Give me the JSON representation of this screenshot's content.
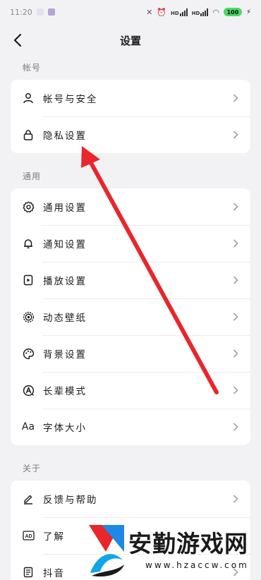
{
  "status_bar": {
    "time": "11:20",
    "battery": "100"
  },
  "header": {
    "title": "设置"
  },
  "sections": [
    {
      "label": "帐号",
      "items": [
        {
          "label": "帐号与安全",
          "icon": "person-icon"
        },
        {
          "label": "隐私设置",
          "icon": "lock-icon"
        }
      ]
    },
    {
      "label": "通用",
      "items": [
        {
          "label": "通用设置",
          "icon": "gear-icon"
        },
        {
          "label": "通知设置",
          "icon": "bell-icon"
        },
        {
          "label": "播放设置",
          "icon": "play-icon"
        },
        {
          "label": "动态壁纸",
          "icon": "target-icon"
        },
        {
          "label": "背景设置",
          "icon": "palette-icon"
        },
        {
          "label": "长辈模式",
          "icon": "elder-icon"
        },
        {
          "label": "字体大小",
          "icon": "font-icon"
        }
      ]
    },
    {
      "label": "关于",
      "items": [
        {
          "label": "反馈与帮助",
          "icon": "edit-icon"
        },
        {
          "label": "了解",
          "icon": "ad-icon"
        },
        {
          "label": "抖音",
          "icon": "document-icon"
        }
      ]
    }
  ],
  "annotation": {
    "arrow_color": "#e8262b"
  },
  "watermark": {
    "text": "安勤游戏网",
    "url": "www.hzaccw.com"
  }
}
